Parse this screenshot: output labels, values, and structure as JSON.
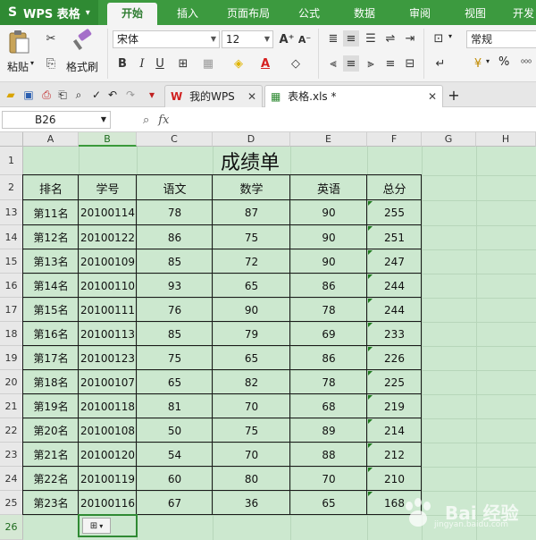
{
  "app": {
    "name": "WPS 表格"
  },
  "menu_tabs": [
    {
      "label": "开始",
      "active": true
    },
    {
      "label": "插入"
    },
    {
      "label": "页面布局"
    },
    {
      "label": "公式"
    },
    {
      "label": "数据"
    },
    {
      "label": "审阅"
    },
    {
      "label": "视图"
    },
    {
      "label": "开发"
    }
  ],
  "ribbon": {
    "paste_label": "粘贴",
    "format_painter_label": "格式刷",
    "font_name": "宋体",
    "font_size": "12",
    "number_format": "常规",
    "percent_symbol": "%"
  },
  "doc_tabs": [
    {
      "label": "我的WPS",
      "active": false
    },
    {
      "label": "表格.xls *",
      "active": true
    }
  ],
  "formula_bar": {
    "name_box": "B26",
    "fx_label": "fx",
    "formula": ""
  },
  "columns": [
    "A",
    "B",
    "C",
    "D",
    "E",
    "F",
    "G",
    "H"
  ],
  "rows": [
    "1",
    "2",
    "13",
    "14",
    "15",
    "16",
    "17",
    "18",
    "19",
    "20",
    "21",
    "22",
    "23",
    "24",
    "25",
    "26"
  ],
  "sheet": {
    "title": "成绩单",
    "headers": [
      "排名",
      "学号",
      "语文",
      "数学",
      "英语",
      "总分"
    ],
    "data": [
      [
        "第11名",
        "20100114",
        "78",
        "87",
        "90",
        "255"
      ],
      [
        "第12名",
        "20100122",
        "86",
        "75",
        "90",
        "251"
      ],
      [
        "第13名",
        "20100109",
        "85",
        "72",
        "90",
        "247"
      ],
      [
        "第14名",
        "20100110",
        "93",
        "65",
        "86",
        "244"
      ],
      [
        "第15名",
        "20100111",
        "76",
        "90",
        "78",
        "244"
      ],
      [
        "第16名",
        "20100113",
        "85",
        "79",
        "69",
        "233"
      ],
      [
        "第17名",
        "20100123",
        "75",
        "65",
        "86",
        "226"
      ],
      [
        "第18名",
        "20100107",
        "65",
        "82",
        "78",
        "225"
      ],
      [
        "第19名",
        "20100118",
        "81",
        "70",
        "68",
        "219"
      ],
      [
        "第20名",
        "20100108",
        "50",
        "75",
        "89",
        "214"
      ],
      [
        "第21名",
        "20100120",
        "54",
        "70",
        "88",
        "212"
      ],
      [
        "第22名",
        "20100119",
        "60",
        "80",
        "70",
        "210"
      ],
      [
        "第23名",
        "20100116",
        "67",
        "36",
        "65",
        "168"
      ]
    ]
  },
  "selected_cell": "B26",
  "colors": {
    "menubar": "#3c9a3f",
    "sheet_bg": "#cce8cf",
    "selection": "#2f8a33"
  },
  "watermark": {
    "text": "Bai 经验",
    "url": "jingyan.baidu.com"
  }
}
